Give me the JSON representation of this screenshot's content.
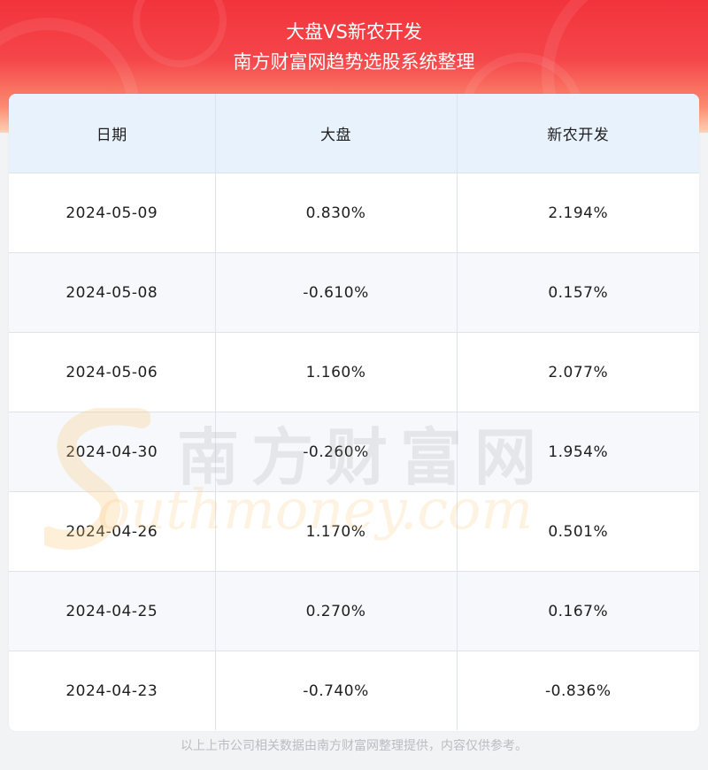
{
  "header": {
    "title": "大盘VS新农开发",
    "subtitle": "南方财富网趋势选股系统整理"
  },
  "table": {
    "columns": [
      "日期",
      "大盘",
      "新农开发"
    ],
    "rows": [
      [
        "2024-05-09",
        "0.830%",
        "2.194%"
      ],
      [
        "2024-05-08",
        "-0.610%",
        "0.157%"
      ],
      [
        "2024-05-06",
        "1.160%",
        "2.077%"
      ],
      [
        "2024-04-30",
        "-0.260%",
        "1.954%"
      ],
      [
        "2024-04-26",
        "1.170%",
        "0.501%"
      ],
      [
        "2024-04-25",
        "0.270%",
        "0.167%"
      ],
      [
        "2024-04-23",
        "-0.740%",
        "-0.836%"
      ]
    ]
  },
  "watermark": {
    "cn": "南方财富网",
    "en": "outhmoney.com"
  },
  "footer": {
    "note": "以上上市公司相关数据由南方财富网整理提供，内容仅供参考。"
  },
  "colors": {
    "banner_red": "#f2333c",
    "header_row_bg": "#e8f2fc",
    "text": "#1e1e1e",
    "footer_text": "#b9bcc2"
  }
}
